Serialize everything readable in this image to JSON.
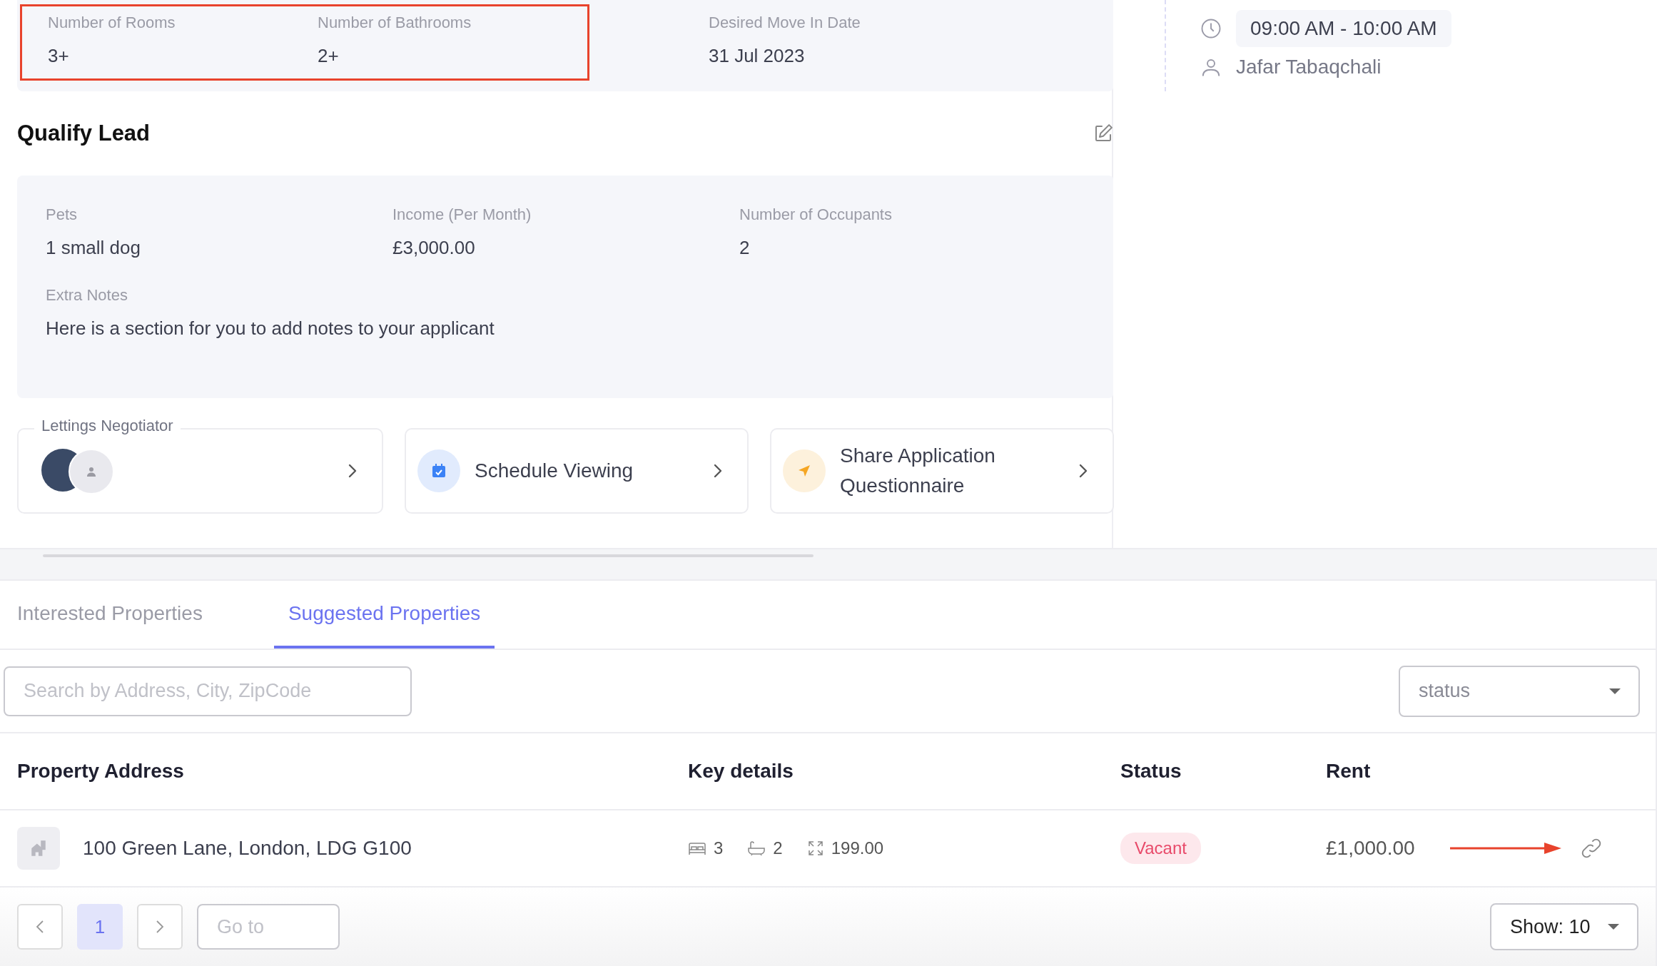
{
  "requirements": {
    "highlighted": true,
    "fields": [
      {
        "label": "Number of Rooms",
        "value": "3+",
        "in_highlight": true
      },
      {
        "label": "Number of Bathrooms",
        "value": "2+",
        "in_highlight": true
      },
      {
        "label": "Desired Move In Date",
        "value": "31 Jul 2023",
        "in_highlight": false
      }
    ]
  },
  "qualify_lead": {
    "title": "Qualify Lead",
    "fields": [
      {
        "label": "Pets",
        "value": "1 small dog"
      },
      {
        "label": "Income (Per Month)",
        "value": "£3,000.00"
      },
      {
        "label": "Number of Occupants",
        "value": "2"
      }
    ],
    "notes": {
      "label": "Extra Notes",
      "value": "Here is a section for you to add notes to your applicant"
    }
  },
  "actions": [
    {
      "kind": "negotiator",
      "label": "Lettings Negotiator"
    },
    {
      "kind": "schedule",
      "label": "Schedule Viewing"
    },
    {
      "kind": "share",
      "label": "Share Application Questionnaire"
    }
  ],
  "viewing": {
    "time": "09:00 AM - 10:00 AM",
    "person": "Jafar Tabaqchali"
  },
  "tabs": [
    {
      "label": "Interested Properties",
      "selected": false
    },
    {
      "label": "Suggested Properties",
      "selected": true
    }
  ],
  "search": {
    "placeholder": "Search by Address, City, ZipCode"
  },
  "status_filter": {
    "value": "status"
  },
  "table": {
    "columns": [
      "Property Address",
      "Key details",
      "Status",
      "Rent"
    ],
    "rows": [
      {
        "address": "100 Green Lane, London, LDG G100",
        "bedrooms": "3",
        "bathrooms": "2",
        "area": "199.00",
        "status": "Vacant",
        "rent": "£1,000.00",
        "pointer_arrow": true
      }
    ]
  },
  "pagination": {
    "pages": [
      {
        "label": "1",
        "selected": true
      }
    ],
    "goto_placeholder": "Go to",
    "page_size": "Show: 10"
  }
}
